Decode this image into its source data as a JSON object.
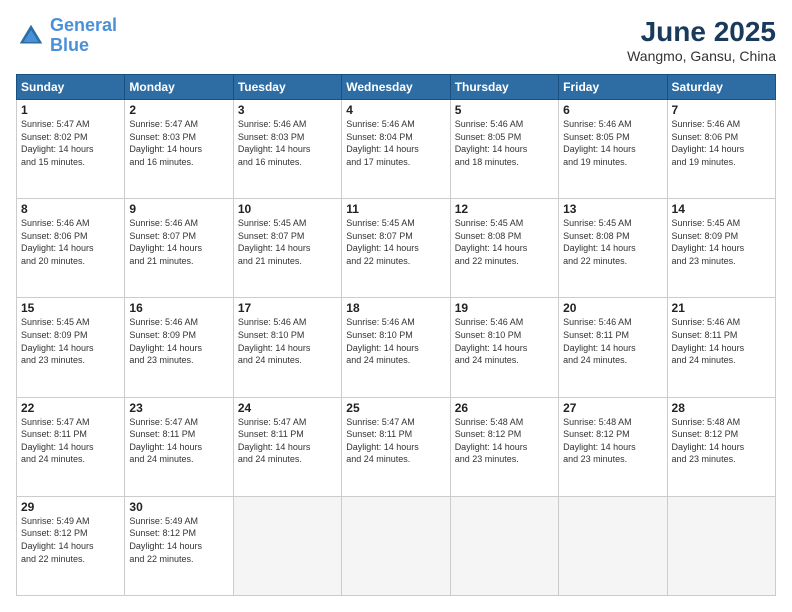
{
  "logo": {
    "line1": "General",
    "line2": "Blue"
  },
  "title": "June 2025",
  "location": "Wangmo, Gansu, China",
  "days_of_week": [
    "Sunday",
    "Monday",
    "Tuesday",
    "Wednesday",
    "Thursday",
    "Friday",
    "Saturday"
  ],
  "weeks": [
    [
      {
        "day": "1",
        "info": "Sunrise: 5:47 AM\nSunset: 8:02 PM\nDaylight: 14 hours\nand 15 minutes."
      },
      {
        "day": "2",
        "info": "Sunrise: 5:47 AM\nSunset: 8:03 PM\nDaylight: 14 hours\nand 16 minutes."
      },
      {
        "day": "3",
        "info": "Sunrise: 5:46 AM\nSunset: 8:03 PM\nDaylight: 14 hours\nand 16 minutes."
      },
      {
        "day": "4",
        "info": "Sunrise: 5:46 AM\nSunset: 8:04 PM\nDaylight: 14 hours\nand 17 minutes."
      },
      {
        "day": "5",
        "info": "Sunrise: 5:46 AM\nSunset: 8:05 PM\nDaylight: 14 hours\nand 18 minutes."
      },
      {
        "day": "6",
        "info": "Sunrise: 5:46 AM\nSunset: 8:05 PM\nDaylight: 14 hours\nand 19 minutes."
      },
      {
        "day": "7",
        "info": "Sunrise: 5:46 AM\nSunset: 8:06 PM\nDaylight: 14 hours\nand 19 minutes."
      }
    ],
    [
      {
        "day": "8",
        "info": "Sunrise: 5:46 AM\nSunset: 8:06 PM\nDaylight: 14 hours\nand 20 minutes."
      },
      {
        "day": "9",
        "info": "Sunrise: 5:46 AM\nSunset: 8:07 PM\nDaylight: 14 hours\nand 21 minutes."
      },
      {
        "day": "10",
        "info": "Sunrise: 5:45 AM\nSunset: 8:07 PM\nDaylight: 14 hours\nand 21 minutes."
      },
      {
        "day": "11",
        "info": "Sunrise: 5:45 AM\nSunset: 8:07 PM\nDaylight: 14 hours\nand 22 minutes."
      },
      {
        "day": "12",
        "info": "Sunrise: 5:45 AM\nSunset: 8:08 PM\nDaylight: 14 hours\nand 22 minutes."
      },
      {
        "day": "13",
        "info": "Sunrise: 5:45 AM\nSunset: 8:08 PM\nDaylight: 14 hours\nand 22 minutes."
      },
      {
        "day": "14",
        "info": "Sunrise: 5:45 AM\nSunset: 8:09 PM\nDaylight: 14 hours\nand 23 minutes."
      }
    ],
    [
      {
        "day": "15",
        "info": "Sunrise: 5:45 AM\nSunset: 8:09 PM\nDaylight: 14 hours\nand 23 minutes."
      },
      {
        "day": "16",
        "info": "Sunrise: 5:46 AM\nSunset: 8:09 PM\nDaylight: 14 hours\nand 23 minutes."
      },
      {
        "day": "17",
        "info": "Sunrise: 5:46 AM\nSunset: 8:10 PM\nDaylight: 14 hours\nand 24 minutes."
      },
      {
        "day": "18",
        "info": "Sunrise: 5:46 AM\nSunset: 8:10 PM\nDaylight: 14 hours\nand 24 minutes."
      },
      {
        "day": "19",
        "info": "Sunrise: 5:46 AM\nSunset: 8:10 PM\nDaylight: 14 hours\nand 24 minutes."
      },
      {
        "day": "20",
        "info": "Sunrise: 5:46 AM\nSunset: 8:11 PM\nDaylight: 14 hours\nand 24 minutes."
      },
      {
        "day": "21",
        "info": "Sunrise: 5:46 AM\nSunset: 8:11 PM\nDaylight: 14 hours\nand 24 minutes."
      }
    ],
    [
      {
        "day": "22",
        "info": "Sunrise: 5:47 AM\nSunset: 8:11 PM\nDaylight: 14 hours\nand 24 minutes."
      },
      {
        "day": "23",
        "info": "Sunrise: 5:47 AM\nSunset: 8:11 PM\nDaylight: 14 hours\nand 24 minutes."
      },
      {
        "day": "24",
        "info": "Sunrise: 5:47 AM\nSunset: 8:11 PM\nDaylight: 14 hours\nand 24 minutes."
      },
      {
        "day": "25",
        "info": "Sunrise: 5:47 AM\nSunset: 8:11 PM\nDaylight: 14 hours\nand 24 minutes."
      },
      {
        "day": "26",
        "info": "Sunrise: 5:48 AM\nSunset: 8:12 PM\nDaylight: 14 hours\nand 23 minutes."
      },
      {
        "day": "27",
        "info": "Sunrise: 5:48 AM\nSunset: 8:12 PM\nDaylight: 14 hours\nand 23 minutes."
      },
      {
        "day": "28",
        "info": "Sunrise: 5:48 AM\nSunset: 8:12 PM\nDaylight: 14 hours\nand 23 minutes."
      }
    ],
    [
      {
        "day": "29",
        "info": "Sunrise: 5:49 AM\nSunset: 8:12 PM\nDaylight: 14 hours\nand 22 minutes."
      },
      {
        "day": "30",
        "info": "Sunrise: 5:49 AM\nSunset: 8:12 PM\nDaylight: 14 hours\nand 22 minutes."
      },
      {
        "day": "",
        "info": ""
      },
      {
        "day": "",
        "info": ""
      },
      {
        "day": "",
        "info": ""
      },
      {
        "day": "",
        "info": ""
      },
      {
        "day": "",
        "info": ""
      }
    ]
  ]
}
